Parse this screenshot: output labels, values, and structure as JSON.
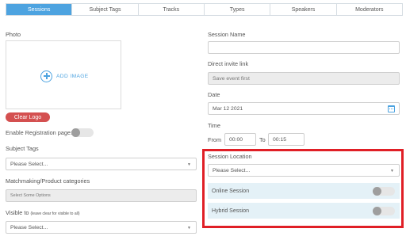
{
  "tabs": [
    {
      "label": "Sessions",
      "active": true
    },
    {
      "label": "Subject Tags",
      "active": false
    },
    {
      "label": "Tracks",
      "active": false
    },
    {
      "label": "Types",
      "active": false
    },
    {
      "label": "Speakers",
      "active": false
    },
    {
      "label": "Moderators",
      "active": false
    }
  ],
  "left": {
    "photo_label": "Photo",
    "add_image": "ADD IMAGE",
    "clear_logo": "Clear Logo",
    "enable_registration_label": "Enable Registration page:",
    "enable_registration_on": false,
    "subject_tags_label": "Subject Tags",
    "subject_tags_value": "Please Select...",
    "matchmaking_label": "Matchmaking/Product categories",
    "matchmaking_placeholder": "Select Some Options",
    "visible_to_label": "Visible to",
    "visible_to_note": "(leave clear for visible to all)",
    "visible_to_value": "Please Select..."
  },
  "right": {
    "session_name_label": "Session Name",
    "session_name_value": "",
    "invite_link_label": "Direct invite link",
    "invite_link_value": "Save event first",
    "date_label": "Date",
    "date_value": "Mar 12 2021",
    "time_label": "Time",
    "from_label": "From",
    "from_value": "00:00",
    "to_label": "To",
    "to_value": "00:15",
    "location_label": "Session Location",
    "location_value": "Please Select...",
    "online_session_label": "Online Session",
    "online_session_on": false,
    "hybrid_session_label": "Hybrid Session",
    "hybrid_session_on": false
  },
  "colors": {
    "accent": "#4da3e0",
    "danger": "#d45050",
    "highlight": "#e01f26",
    "option_bg": "#e4f1f7"
  }
}
